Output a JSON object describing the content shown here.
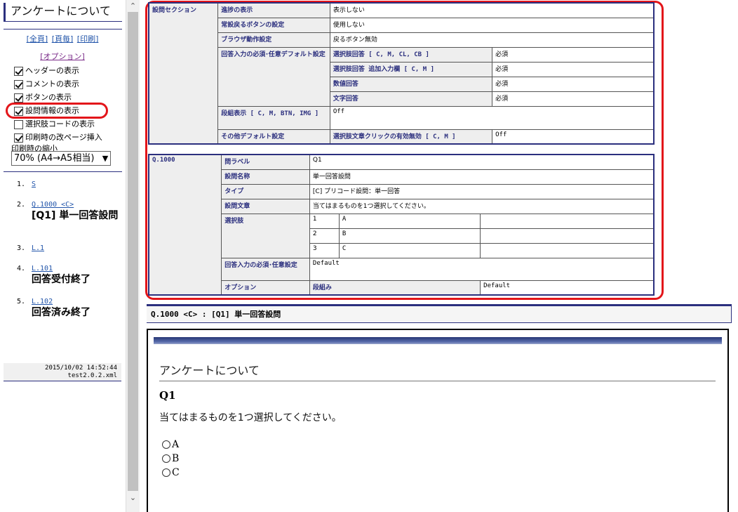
{
  "sidebar": {
    "title": "アンケートについて",
    "links": [
      "[全頁]",
      "[頁毎]",
      "[印刷]"
    ],
    "option_link": "[オプション]",
    "checkboxes": [
      {
        "label": "ヘッダーの表示",
        "checked": true
      },
      {
        "label": "コメントの表示",
        "checked": true
      },
      {
        "label": "ボタンの表示",
        "checked": true
      },
      {
        "label": "設問情報の表示",
        "checked": true
      },
      {
        "label": "選択肢コードの表示",
        "checked": false
      },
      {
        "label": "印刷時の改ページ挿入",
        "checked": true
      }
    ],
    "print_shrink_label": "印刷時の縮小",
    "print_shrink_value": "70% (A4→A5相当)",
    "nav": [
      {
        "num": "1.",
        "link": "S",
        "text": ""
      },
      {
        "num": "2.",
        "link": "Q.1000 <C>",
        "text": "[Q1] 単一回答設問"
      },
      {
        "num": "3.",
        "link": "L.1",
        "text": ""
      },
      {
        "num": "4.",
        "link": "L.101",
        "text": "回答受付終了"
      },
      {
        "num": "5.",
        "link": "L.102",
        "text": "回答済み終了"
      }
    ],
    "timestamp": "2015/10/02 14:52:44",
    "filename": "test2.0.2.xml"
  },
  "section_table": {
    "section_label": "設問セクション",
    "rows": {
      "progress": {
        "label": "進捗の表示",
        "value": "表示しない"
      },
      "back_button": {
        "label": "常設戻るボタンの設定",
        "value": "使用しない"
      },
      "browser": {
        "label": "ブラウザ動作設定",
        "value": "戻るボタン無効"
      },
      "required_label": "回答入力の必須･任意デフォルト設定",
      "required": [
        {
          "label": "選択肢回答 [ C, M, CL, CB ]",
          "value": "必須"
        },
        {
          "label": "選択肢回答 追加入力欄 [ C, M ]",
          "value": "必須"
        },
        {
          "label": "数値回答",
          "value": "必須"
        },
        {
          "label": "文字回答",
          "value": "必須"
        }
      ],
      "columns": {
        "label": "段組表示 [ C, M, BTN, IMG ]",
        "value": "Off"
      },
      "other_label": "その他デフォルト設定",
      "other": {
        "label": "選択肢文章クリックの有効無効 [ C, M ]",
        "value": "Off"
      }
    }
  },
  "question_table": {
    "id": "Q.1000",
    "label_row": {
      "label": "問ラベル",
      "value": "Q1"
    },
    "name_row": {
      "label": "設問名称",
      "value": "単一回答設問"
    },
    "type_row": {
      "label": "タイプ",
      "value": "[C] プリコード設問：単一回答"
    },
    "text_row": {
      "label": "設問文章",
      "value": "当てはまるものを1つ選択してください。"
    },
    "choices_label": "選択肢",
    "choices": [
      {
        "code": "1",
        "text": "A"
      },
      {
        "code": "2",
        "text": "B"
      },
      {
        "code": "3",
        "text": "C"
      }
    ],
    "required_row": {
      "label": "回答入力の必須･任意設定",
      "value": "Default"
    },
    "option_row": {
      "label": "オプション",
      "sub_label": "段組み",
      "value": "Default"
    }
  },
  "question_bar": "Q.1000 <C> : [Q1] 単一回答設問",
  "preview": {
    "title": "アンケートについて",
    "q_label": "Q1",
    "q_text": "当てはまるものを1つ選択してください。",
    "options": [
      "A",
      "B",
      "C"
    ]
  },
  "colors": {
    "accent_navy": "#2b2f7e",
    "highlight_red": "#e3151a",
    "link_blue": "#2255aa"
  }
}
